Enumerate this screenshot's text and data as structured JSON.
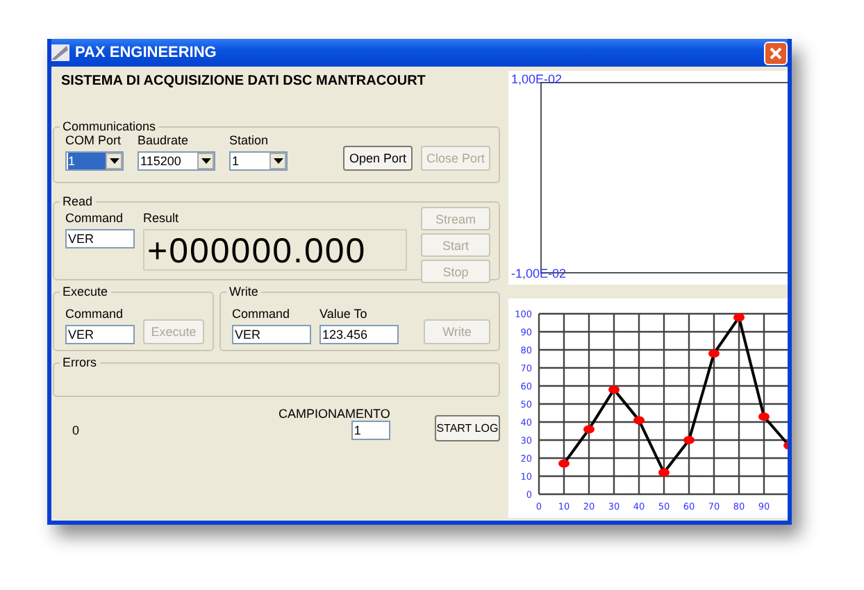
{
  "window": {
    "title": "PAX ENGINEERING"
  },
  "heading": "SISTEMA DI ACQUISIZIONE DATI DSC MANTRACOURT",
  "communications": {
    "label": "Communications",
    "fields": [
      {
        "label": "COM Port",
        "value": "1",
        "highlighted": true
      },
      {
        "label": "Baudrate",
        "value": "115200",
        "highlighted": false
      },
      {
        "label": "Station",
        "value": "1",
        "highlighted": false
      }
    ],
    "buttons": [
      {
        "label": "Open Port",
        "disabled": false
      },
      {
        "label": "Close Port",
        "disabled": true
      }
    ]
  },
  "read": {
    "label": "Read",
    "command_label": "Command",
    "command": "VER",
    "result_label": "Result",
    "result": "+000000.000",
    "buttons": [
      {
        "label": "Stream",
        "disabled": true
      },
      {
        "label": "Start",
        "disabled": true
      },
      {
        "label": "Stop",
        "disabled": true
      }
    ]
  },
  "execute": {
    "label": "Execute",
    "command_label": "Command",
    "command": "VER",
    "button": {
      "label": "Execute",
      "disabled": true
    }
  },
  "write": {
    "label": "Write",
    "command_label": "Command",
    "command": "VER",
    "value_label": "Value To",
    "value": "123.456",
    "button": {
      "label": "Write",
      "disabled": true
    }
  },
  "errors": {
    "label": "Errors"
  },
  "counter": "0",
  "sampling": {
    "label": "CAMPIONAMENTO",
    "value": "1"
  },
  "log_button": {
    "label": "START LOG",
    "disabled": false
  },
  "scope": {
    "top_label": "1,00E-02",
    "bottom_label": "-1,00E-02"
  },
  "chart": {
    "chart_data": {
      "type": "line",
      "x": [
        10,
        20,
        30,
        40,
        50,
        60,
        70,
        80,
        90,
        100
      ],
      "series": [
        {
          "color": "#000000",
          "values": [
            17,
            36,
            58,
            41,
            12,
            30,
            78,
            98,
            43,
            27
          ]
        }
      ],
      "xlim": [
        0,
        100
      ],
      "ylim": [
        0,
        100
      ],
      "xticks": [
        0,
        10,
        20,
        30,
        40,
        50,
        60,
        70,
        80,
        90
      ],
      "yticks": [
        0,
        10,
        20,
        30,
        40,
        50,
        60,
        70,
        80,
        90,
        100
      ],
      "grid": true,
      "marker": "circle"
    }
  }
}
